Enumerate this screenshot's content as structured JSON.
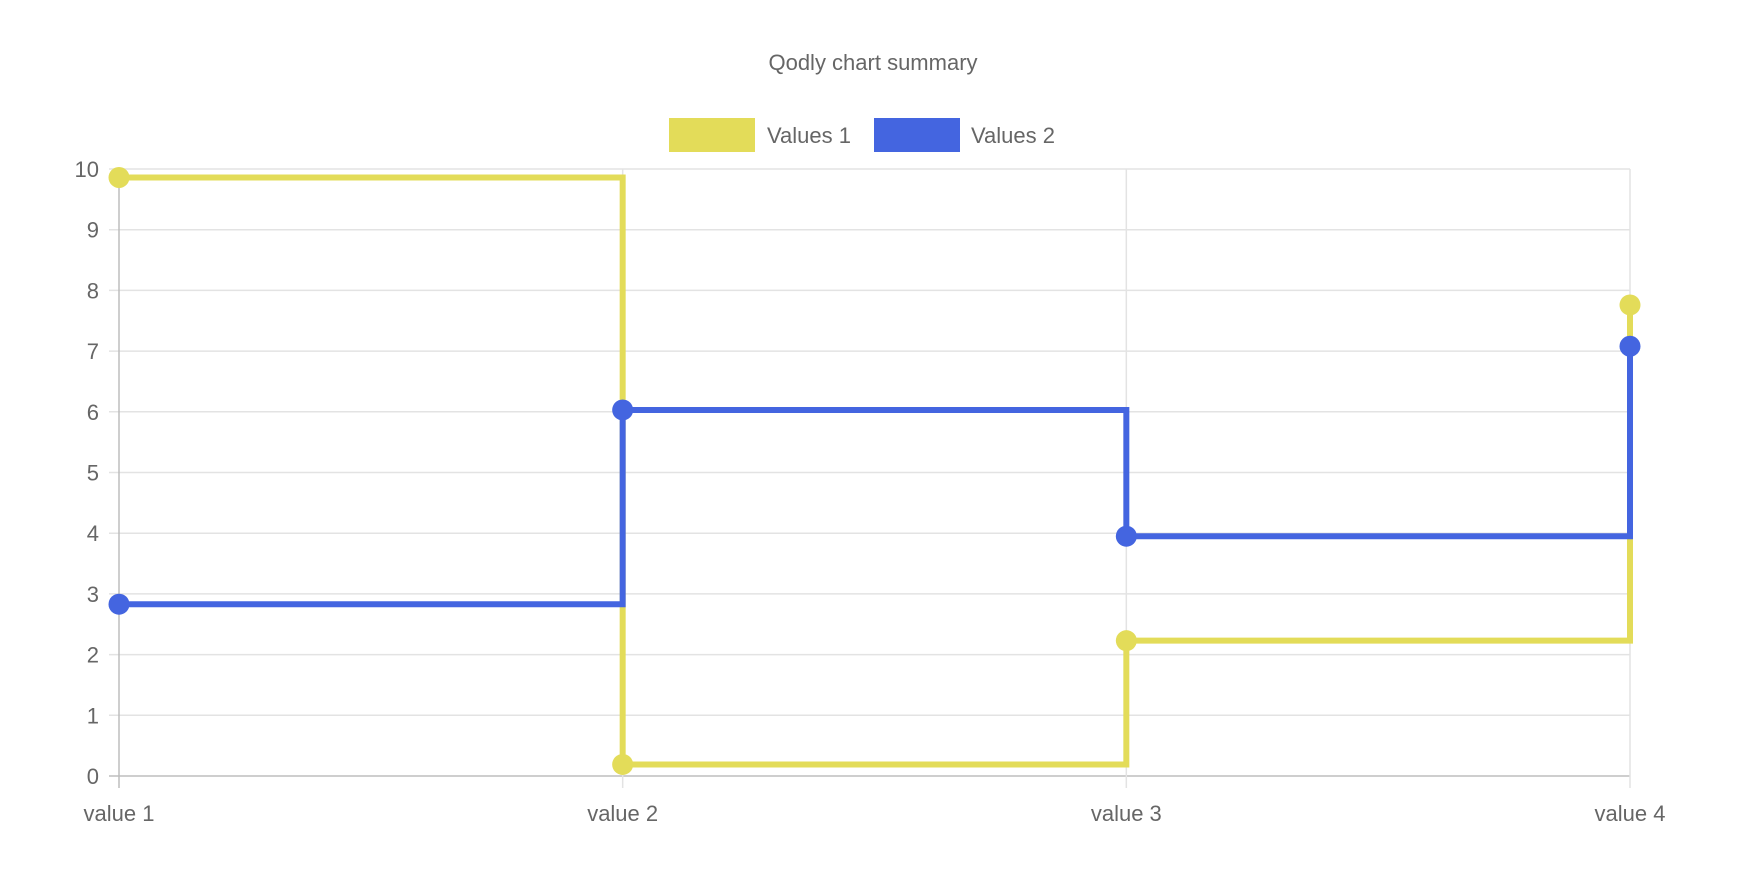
{
  "chart_data": {
    "type": "line",
    "title": "Qodly chart summary",
    "step": "before",
    "categories": [
      "value 1",
      "value 2",
      "value 3",
      "value 4"
    ],
    "ylim": [
      0,
      10
    ],
    "yticks": [
      0,
      1,
      2,
      3,
      4,
      5,
      6,
      7,
      8,
      9,
      10
    ],
    "grid": true,
    "legend_position": "top",
    "series": [
      {
        "name": "Values 1",
        "values": [
          9.86,
          0.19,
          2.23,
          7.76
        ],
        "color": "#e3dc59"
      },
      {
        "name": "Values 2",
        "values": [
          2.83,
          6.03,
          3.95,
          7.08
        ],
        "color": "#4465e0"
      }
    ]
  }
}
